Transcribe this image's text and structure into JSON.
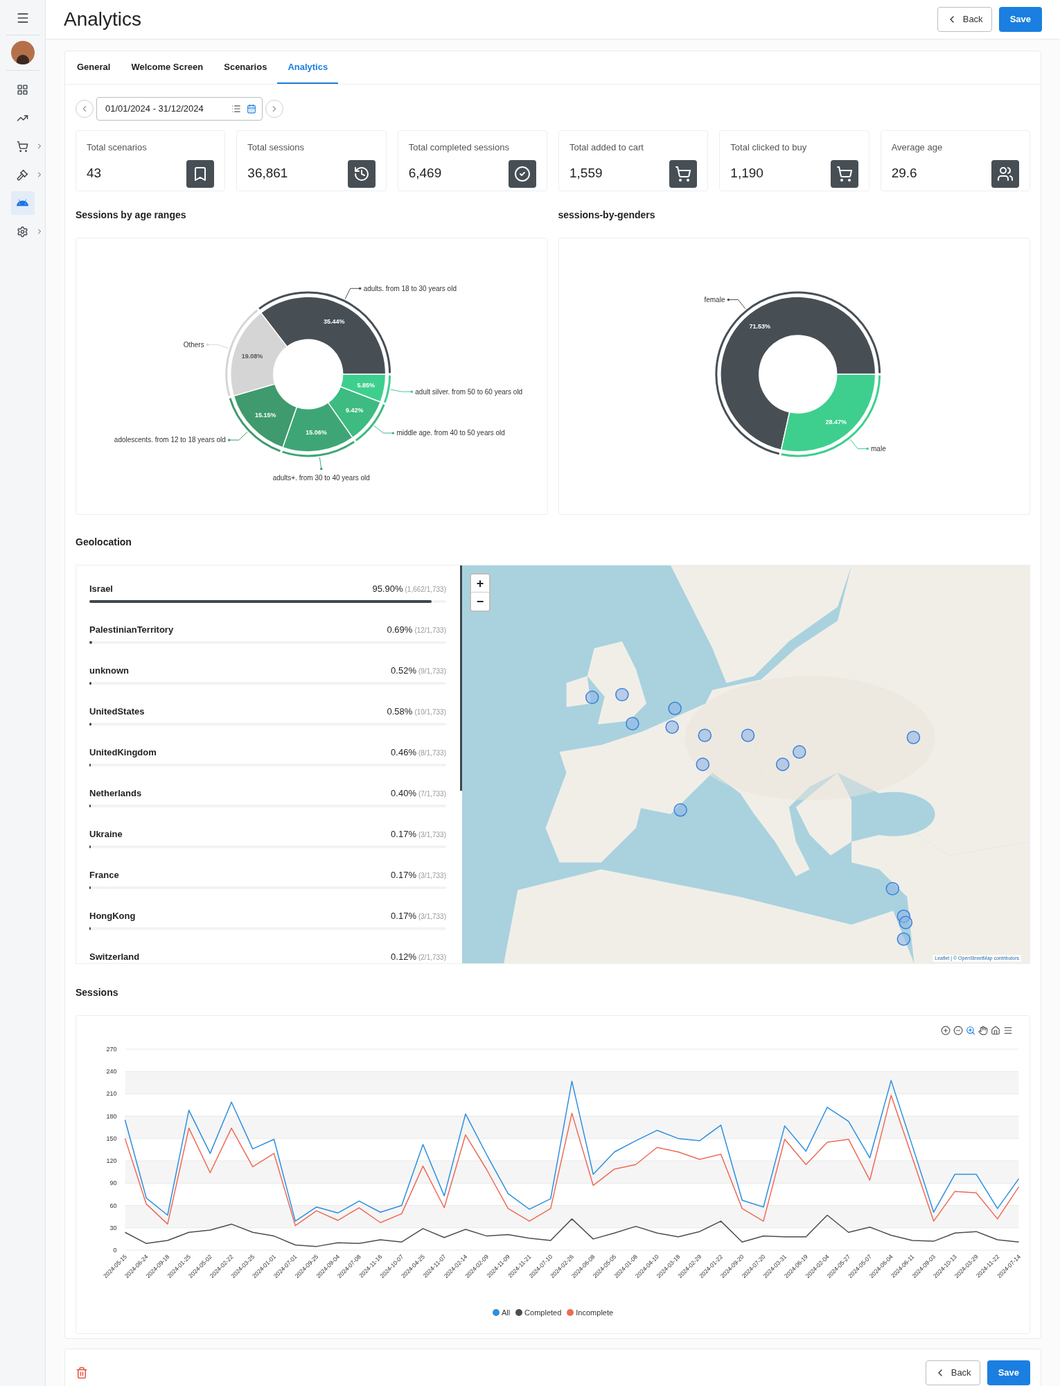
{
  "sidebar": {
    "items": [
      {
        "selected": false,
        "has_submenu": false
      },
      {
        "selected": false,
        "has_submenu": false
      },
      {
        "selected": false,
        "has_submenu": true
      },
      {
        "selected": false,
        "has_submenu": true
      },
      {
        "selected": true,
        "has_submenu": false
      },
      {
        "selected": false,
        "has_submenu": true
      }
    ]
  },
  "header": {
    "title": "Analytics",
    "buttons": [
      {
        "label": "Back",
        "kind": "back"
      },
      {
        "label": "Save",
        "kind": "primary"
      }
    ]
  },
  "tabs": [
    {
      "label": "General",
      "selected": false
    },
    {
      "label": "Welcome Screen",
      "selected": false
    },
    {
      "label": "Scenarios",
      "selected": false
    },
    {
      "label": "Analytics",
      "selected": true
    }
  ],
  "date_range": {
    "value": "01/01/2024 - 31/12/2024"
  },
  "stats": [
    {
      "label": "Total scenarios",
      "value": "43"
    },
    {
      "label": "Total sessions",
      "value": "36,861"
    },
    {
      "label": "Total completed sessions",
      "value": "6,469"
    },
    {
      "label": "Total added to cart",
      "value": "1,559"
    },
    {
      "label": "Total clicked to buy",
      "value": "1,190"
    },
    {
      "label": "Average age",
      "value": "29.6"
    }
  ],
  "age_chart": {
    "title": "Sessions by age ranges",
    "chart_data": {
      "type": "donut",
      "categories": [
        "adults. from 18 to 30 years old",
        "adult silver. from 50 to 60 years old",
        "middle age. from 40 to 50 years old",
        "adults+. from 30 to 40 years old",
        "adolescents. from 12 to 18 years old",
        "Others"
      ],
      "values": [
        35.44,
        5.85,
        9.42,
        15.06,
        15.15,
        19.08
      ],
      "value_labels": [
        "35.44%",
        "5.85%",
        "9.42%",
        "15.06%",
        "15.15%",
        "19.08%"
      ]
    }
  },
  "gender_chart": {
    "title": "sessions-by-genders",
    "chart_data": {
      "type": "donut",
      "categories": [
        "female",
        "male"
      ],
      "values": [
        71.53,
        28.47
      ],
      "value_labels": [
        "71.53%",
        "28.47%"
      ]
    }
  },
  "geolocation": {
    "title": "Geolocation",
    "countries": [
      {
        "name": "Israel",
        "share": "95.90%",
        "count": "(1,662/1,733)",
        "level": 0.959
      },
      {
        "name": "PalestinianTerritory",
        "share": "0.69%",
        "count": "(12/1,733)",
        "level": 0.0069
      },
      {
        "name": "unknown",
        "share": "0.52%",
        "count": "(9/1,733)",
        "level": 0.0052
      },
      {
        "name": "UnitedStates",
        "share": "0.58%",
        "count": "(10/1,733)",
        "level": 0.0058
      },
      {
        "name": "UnitedKingdom",
        "share": "0.46%",
        "count": "(8/1,733)",
        "level": 0.0046
      },
      {
        "name": "Netherlands",
        "share": "0.40%",
        "count": "(7/1,733)",
        "level": 0.004
      },
      {
        "name": "Ukraine",
        "share": "0.17%",
        "count": "(3/1,733)",
        "level": 0.0017
      },
      {
        "name": "France",
        "share": "0.17%",
        "count": "(3/1,733)",
        "level": 0.0017
      },
      {
        "name": "HongKong",
        "share": "0.17%",
        "count": "(3/1,733)",
        "level": 0.0017
      },
      {
        "name": "Switzerland",
        "share": "0.12%",
        "count": "(2/1,733)"
      }
    ],
    "map": {
      "zoom_in": "+",
      "zoom_out": "−",
      "attribution": "Leaflet | © OpenStreetMap contributors"
    }
  },
  "sessions": {
    "title": "Sessions",
    "tools": [
      {
        "selected": false
      },
      {
        "selected": false
      },
      {
        "selected": true
      },
      {
        "selected": false
      },
      {
        "selected": false
      },
      {
        "selected": false
      }
    ],
    "chart_data": {
      "type": "line",
      "categories": [
        "2024-05-15",
        "2024-06-24",
        "2024-09-18",
        "2024-01-25",
        "2024-05-02",
        "2024-02-22",
        "2024-03-25",
        "2024-01-01",
        "2024-07-01",
        "2024-09-25",
        "2024-09-04",
        "2024-07-08",
        "2024-11-16",
        "2024-10-07",
        "2024-04-25",
        "2024-11-07",
        "2024-02-14",
        "2024-02-09",
        "2024-11-09",
        "2024-11-21",
        "2024-07-10",
        "2024-02-26",
        "2024-06-08",
        "2024-05-05",
        "2024-01-08",
        "2024-04-10",
        "2024-03-18",
        "2024-02-29",
        "2024-01-22",
        "2024-09-20",
        "2024-07-20",
        "2024-03-31",
        "2024-06-19",
        "2024-02-04",
        "2024-05-27",
        "2024-05-07",
        "2024-06-04",
        "2024-06-11",
        "2024-09-03",
        "2024-10-13",
        "2024-03-29",
        "2024-11-22",
        "2024-07-14"
      ],
      "series": [
        {
          "name": "All",
          "color": "#2e8fe0",
          "values": [
            175,
            70,
            47,
            188,
            130,
            199,
            136,
            149,
            39,
            58,
            50,
            66,
            51,
            60,
            142,
            73,
            183,
            128,
            76,
            55,
            69,
            227,
            102,
            132,
            147,
            161,
            150,
            147,
            168,
            67,
            58,
            167,
            133,
            192,
            173,
            124,
            228,
            140,
            51,
            102,
            102,
            56,
            96
          ]
        },
        {
          "name": "Completed",
          "color": "#474f55",
          "values": [
            24,
            9,
            13,
            24,
            27,
            35,
            24,
            19,
            7,
            5,
            10,
            9,
            14,
            11,
            29,
            17,
            28,
            19,
            21,
            16,
            13,
            42,
            15,
            23,
            32,
            23,
            18,
            25,
            39,
            11,
            19,
            18,
            18,
            47,
            24,
            31,
            20,
            13,
            12,
            23,
            25,
            14,
            11
          ]
        },
        {
          "name": "Incomplete",
          "color": "#ef6a55",
          "values": [
            150,
            62,
            35,
            164,
            104,
            164,
            112,
            130,
            33,
            53,
            40,
            57,
            37,
            49,
            113,
            57,
            155,
            108,
            56,
            39,
            56,
            184,
            87,
            109,
            115,
            138,
            132,
            122,
            129,
            56,
            39,
            149,
            115,
            145,
            149,
            94,
            208,
            124,
            39,
            79,
            77,
            42,
            85
          ]
        }
      ],
      "grid": true,
      "ylim": [
        0,
        270
      ],
      "yticks": [
        0,
        30,
        60,
        90,
        120,
        150,
        180,
        210,
        240,
        270
      ]
    }
  },
  "footer": {
    "buttons": [
      {
        "label": "Back",
        "kind": "back"
      },
      {
        "label": "Save",
        "kind": "primary"
      }
    ]
  }
}
